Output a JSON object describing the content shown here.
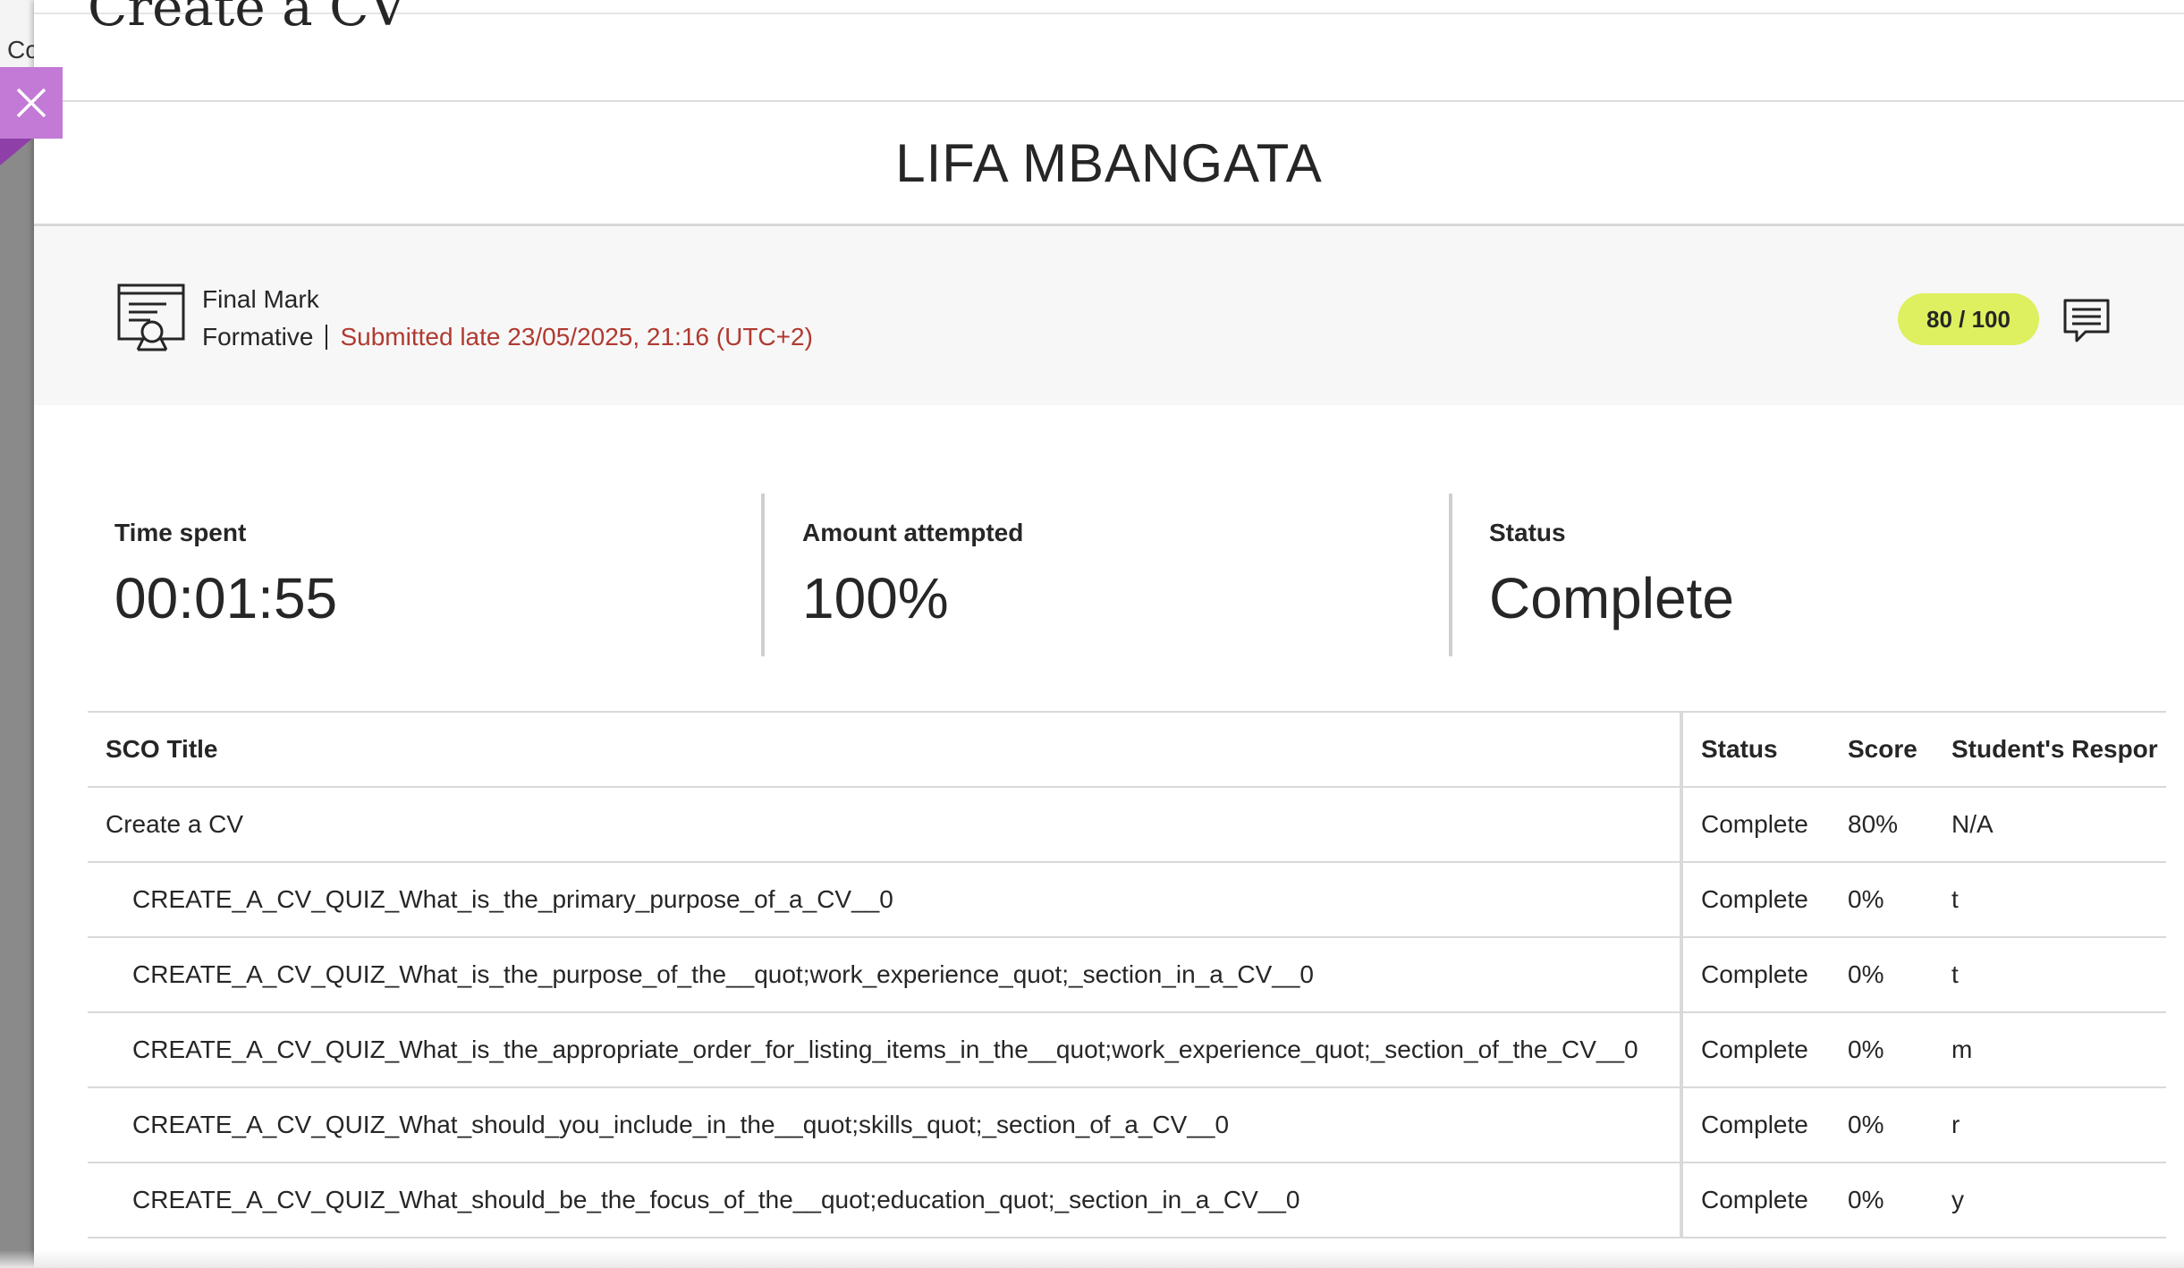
{
  "backdrop": {
    "text": "Co"
  },
  "panel": {
    "title": "Create a CV",
    "student_name": "LIFA MBANGATA"
  },
  "grade": {
    "icon": "certificate-icon",
    "heading": "Final Mark",
    "category": "Formative",
    "submission": "Submitted late 23/05/2025, 21:16 (UTC+2)",
    "score": "80 / 100",
    "feedback_icon": "comment-icon"
  },
  "stats": [
    {
      "label": "Time spent",
      "value": "00:01:55"
    },
    {
      "label": "Amount attempted",
      "value": "100%"
    },
    {
      "label": "Status",
      "value": "Complete"
    }
  ],
  "table": {
    "headers": [
      "SCO Title",
      "Status",
      "Score",
      "Student's Respor"
    ],
    "rows": [
      {
        "title": "Create a CV",
        "status": "Complete",
        "score": "80%",
        "response": "N/A"
      },
      {
        "title": "CREATE_A_CV_QUIZ_What_is_the_primary_purpose_of_a_CV__0",
        "status": "Complete",
        "score": "0%",
        "response": "t"
      },
      {
        "title": "CREATE_A_CV_QUIZ_What_is_the_purpose_of_the__quot;work_experience_quot;_section_in_a_CV__0",
        "status": "Complete",
        "score": "0%",
        "response": "t"
      },
      {
        "title": "CREATE_A_CV_QUIZ_What_is_the_appropriate_order_for_listing_items_in_the__quot;work_experience_quot;_section_of_the_CV__0",
        "status": "Complete",
        "score": "0%",
        "response": "m"
      },
      {
        "title": "CREATE_A_CV_QUIZ_What_should_you_include_in_the__quot;skills_quot;_section_of_a_CV__0",
        "status": "Complete",
        "score": "0%",
        "response": "r"
      },
      {
        "title": "CREATE_A_CV_QUIZ_What_should_be_the_focus_of_the__quot;education_quot;_section_in_a_CV__0",
        "status": "Complete",
        "score": "0%",
        "response": "y"
      }
    ]
  },
  "colors": {
    "accent_purple": "#c27ad6",
    "score_pill": "#def05f",
    "late_text": "#b03a30"
  }
}
